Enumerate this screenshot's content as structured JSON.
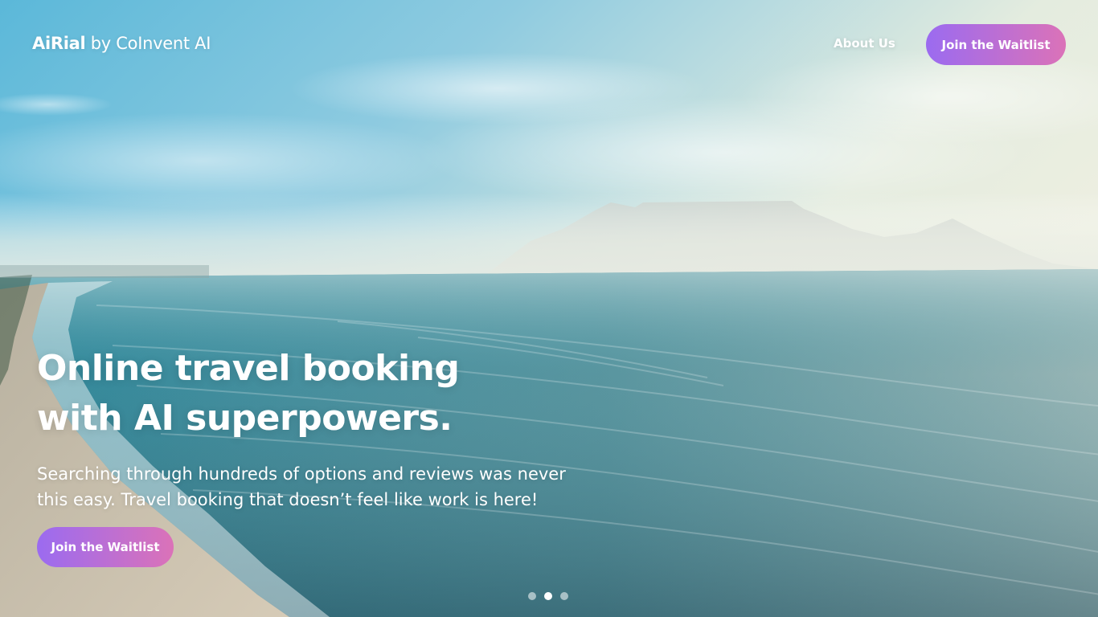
{
  "brand": {
    "name_strong": "AiRial",
    "name_rest": " by CoInvent AI"
  },
  "nav": {
    "about_label": "About Us",
    "waitlist_label": "Join the Waitlist"
  },
  "hero": {
    "headline_lines": [
      "Online travel booking",
      "with AI superpowers."
    ],
    "subtext_lines": [
      "Searching through hundreds of options and reviews was never",
      "this easy. Travel booking that doesn’t feel like work is here!"
    ],
    "cta_label": "Join the Waitlist",
    "background_image": "aerial-coastline-table-mountain"
  },
  "carousel": {
    "slide_count": 3,
    "active_index": 1
  },
  "colors": {
    "button_gradient_start": "#9B6BF0",
    "button_gradient_end": "#DB72B8",
    "text": "#FFFFFF"
  }
}
